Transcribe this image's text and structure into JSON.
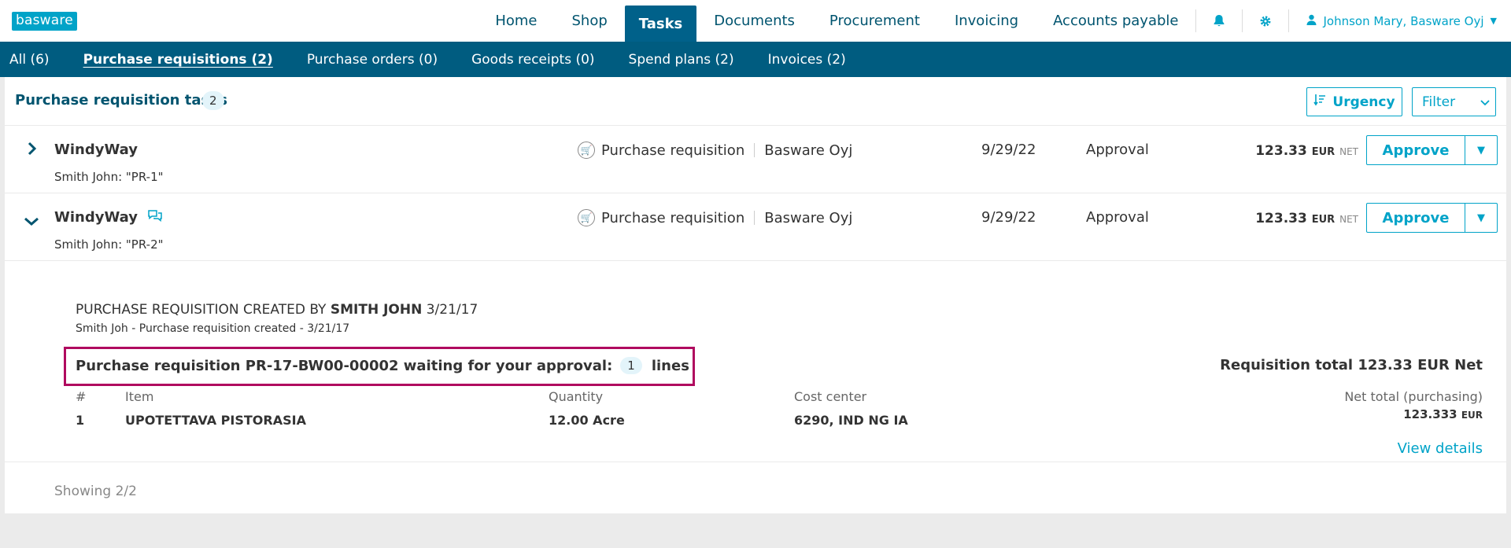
{
  "app": {
    "logo": "basware"
  },
  "main_nav": [
    {
      "label": "Home",
      "active": false
    },
    {
      "label": "Shop",
      "active": false
    },
    {
      "label": "Tasks",
      "active": true
    },
    {
      "label": "Documents",
      "active": false
    },
    {
      "label": "Procurement",
      "active": false
    },
    {
      "label": "Invoicing",
      "active": false
    },
    {
      "label": "Accounts payable",
      "active": false
    }
  ],
  "user": {
    "name": "Johnson Mary, Basware Oyj"
  },
  "sub_nav": [
    {
      "label": "All (6)",
      "active": false
    },
    {
      "label": "Purchase requisitions (2)",
      "active": true
    },
    {
      "label": "Purchase orders (0)",
      "active": false
    },
    {
      "label": "Goods receipts (0)",
      "active": false
    },
    {
      "label": "Spend plans (2)",
      "active": false
    },
    {
      "label": "Invoices (2)",
      "active": false
    }
  ],
  "panel": {
    "title": "Purchase requisition tasks",
    "count": "2",
    "urgency_label": "Urgency",
    "filter_label": "Filter"
  },
  "tasks": [
    {
      "vendor": "WindyWay",
      "subline": "Smith John: \"PR-1\"",
      "type": "Purchase requisition",
      "company": "Basware Oyj",
      "date": "9/29/22",
      "stage": "Approval",
      "amount": "123.33",
      "currency": "EUR",
      "net": "NET",
      "approve_label": "Approve",
      "expanded": false
    },
    {
      "vendor": "WindyWay",
      "subline": "Smith John: \"PR-2\"",
      "type": "Purchase requisition",
      "company": "Basware Oyj",
      "date": "9/29/22",
      "stage": "Approval",
      "amount": "123.33",
      "currency": "EUR",
      "net": "NET",
      "approve_label": "Approve",
      "expanded": true
    }
  ],
  "detail": {
    "created_prefix": "PURCHASE REQUISITION CREATED BY",
    "created_by": "SMITH JOHN",
    "created_date": "3/21/17",
    "created_sub": "Smith Joh - Purchase requisition created - 3/21/17",
    "waiting_text": "Purchase requisition PR-17-BW00-00002 waiting for your approval:",
    "lines_count": "1",
    "lines_word": "lines",
    "requisition_total": "Requisition total 123.33 EUR Net",
    "columns": {
      "num": "#",
      "item": "Item",
      "quantity": "Quantity",
      "cost_center": "Cost center",
      "net_total": "Net total (purchasing)"
    },
    "row": {
      "num": "1",
      "item": "UPOTETTAVA PISTORASIA",
      "quantity": "12.00 Acre",
      "cost_center": "6290, IND NG IA",
      "net_value": "123.333",
      "currency": "EUR"
    },
    "view_details": "View details"
  },
  "footer": {
    "showing": "Showing 2/2"
  },
  "colors": {
    "brand": "#00a3c8",
    "nav_dark": "#005c80",
    "highlight": "#b00a5f"
  }
}
